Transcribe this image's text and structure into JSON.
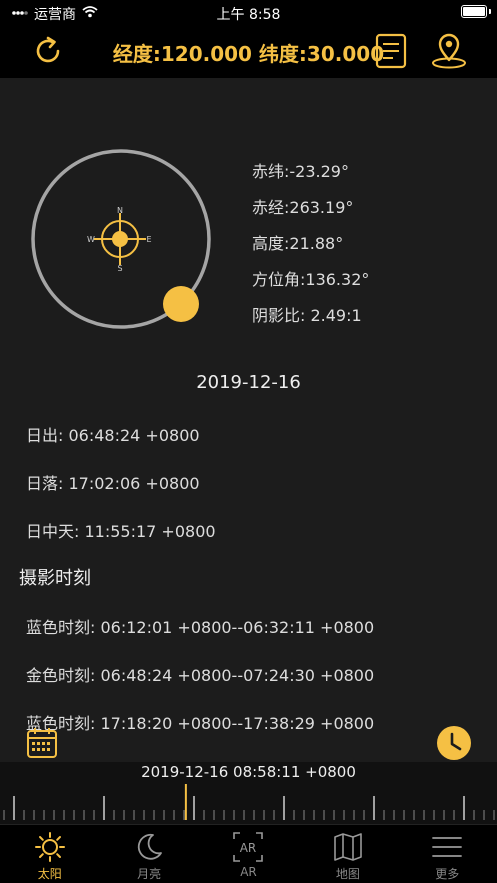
{
  "status": {
    "carrier": "运营商",
    "time": "上午 8:58"
  },
  "header": {
    "coordinates": "经度:120.000 纬度:30.000"
  },
  "compass": {
    "north": "N",
    "south": "S",
    "east": "E",
    "west": "W"
  },
  "sun_info": [
    {
      "key": "declination",
      "text": "赤纬:-23.29°"
    },
    {
      "key": "right_ascension",
      "text": "赤经:263.19°"
    },
    {
      "key": "altitude",
      "text": "高度:21.88°"
    },
    {
      "key": "azimuth",
      "text": "方位角:136.32°"
    },
    {
      "key": "shadow_ratio",
      "text": "阴影比:  2.49:1"
    }
  ],
  "date": "2019-12-16",
  "sun_times": [
    {
      "text": "日出:  06:48:24 +0800"
    },
    {
      "text": "日落:  17:02:06 +0800"
    },
    {
      "text": "日中天:  11:55:17 +0800"
    }
  ],
  "photo_section": {
    "title": "摄影时刻"
  },
  "photo_times": [
    {
      "text": "蓝色时刻:  06:12:01 +0800--06:32:11 +0800"
    },
    {
      "text": "金色时刻:  06:48:24 +0800--07:24:30 +0800"
    },
    {
      "text": "蓝色时刻:  17:18:20 +0800--17:38:29 +0800"
    }
  ],
  "timeline": {
    "current": "2019-12-16 08:58:11 +0800",
    "progress": 0.374
  },
  "tabs": [
    {
      "label": "太阳",
      "icon": "sun-icon",
      "active": true
    },
    {
      "label": "月亮",
      "icon": "moon-icon",
      "active": false
    },
    {
      "label": "AR",
      "icon": "ar-icon",
      "active": false,
      "glyph": "AR"
    },
    {
      "label": "地图",
      "icon": "map-icon",
      "active": false
    },
    {
      "label": "更多",
      "icon": "menu-icon",
      "active": false
    }
  ],
  "colors": {
    "accent": "#f5c044",
    "background": "#1c1c1c",
    "bar": "#000000"
  }
}
